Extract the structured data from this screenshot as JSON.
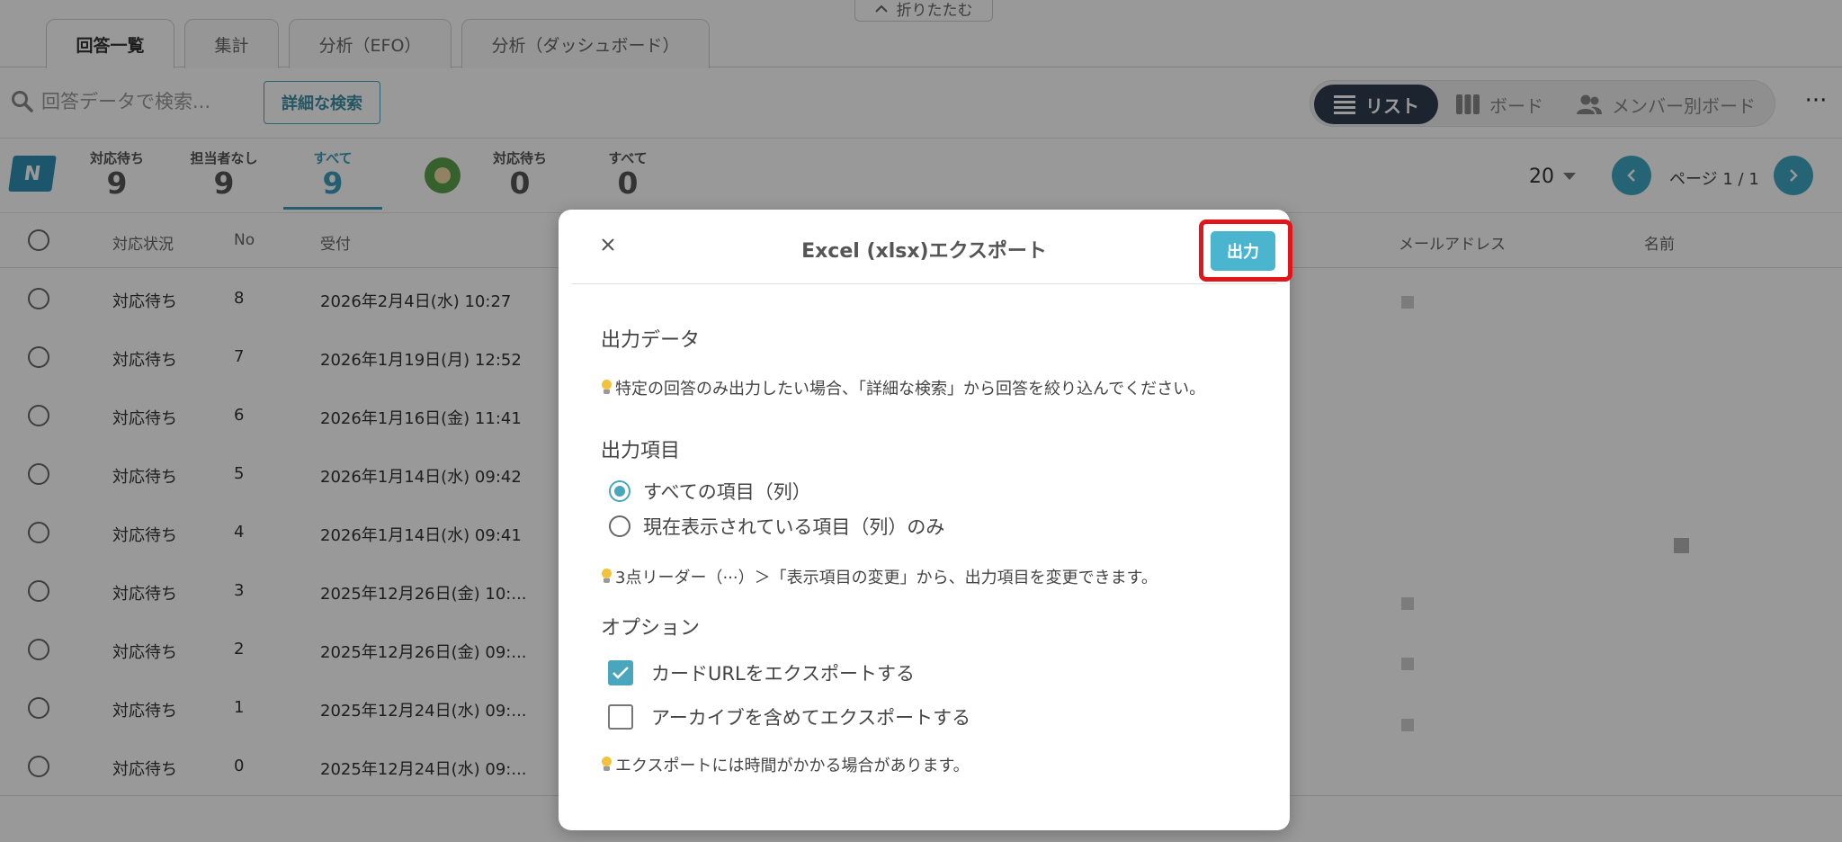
{
  "header": {
    "collapse_label": "折りたたむ",
    "tabs": [
      {
        "label": "回答一覧"
      },
      {
        "label": "集計"
      },
      {
        "label": "分析（EFO）"
      },
      {
        "label": "分析（ダッシュボード）"
      }
    ]
  },
  "toolbar": {
    "search_placeholder": "回答データで検索...",
    "advanced_search_label": "詳細な検索",
    "views": [
      {
        "label": "リスト"
      },
      {
        "label": "ボード"
      },
      {
        "label": "メンバー別ボード"
      }
    ]
  },
  "counters": {
    "logo_letter": "N",
    "team": [
      {
        "label": "対応待ち",
        "value": "9"
      },
      {
        "label": "担当者なし",
        "value": "9"
      },
      {
        "label": "すべて",
        "value": "9"
      }
    ],
    "mine": [
      {
        "label": "対応待ち",
        "value": "0"
      },
      {
        "label": "すべて",
        "value": "0"
      }
    ],
    "per_page": "20",
    "page_label": "ページ 1 / 1"
  },
  "table": {
    "headers": {
      "status": "対応状況",
      "no": "No",
      "received": "受付",
      "email": "メールアドレス",
      "name": "名前"
    },
    "rows": [
      {
        "status": "対応待ち",
        "no": "8",
        "received": "2026年2月4日(水) 10:27"
      },
      {
        "status": "対応待ち",
        "no": "7",
        "received": "2026年1月19日(月) 12:52"
      },
      {
        "status": "対応待ち",
        "no": "6",
        "received": "2026年1月16日(金) 11:41"
      },
      {
        "status": "対応待ち",
        "no": "5",
        "received": "2026年1月14日(水) 09:42"
      },
      {
        "status": "対応待ち",
        "no": "4",
        "received": "2026年1月14日(水) 09:41"
      },
      {
        "status": "対応待ち",
        "no": "3",
        "received": "2025年12月26日(金) 10:..."
      },
      {
        "status": "対応待ち",
        "no": "2",
        "received": "2025年12月26日(金) 09:..."
      },
      {
        "status": "対応待ち",
        "no": "1",
        "received": "2025年12月24日(水) 09:..."
      },
      {
        "status": "対応待ち",
        "no": "0",
        "received": "2025年12月24日(水) 09:..."
      }
    ]
  },
  "modal": {
    "title": "Excel (xlsx)エクスポート",
    "export_label": "出力",
    "output_data_title": "出力データ",
    "output_data_hint": "特定の回答のみ出力したい場合、「詳細な検索」から回答を絞り込んでください。",
    "output_items_title": "出力項目",
    "radio_all": "すべての項目（列）",
    "radio_visible": "現在表示されている項目（列）のみ",
    "items_hint": "3点リーダー（···）＞「表示項目の変更」から、出力項目を変更できます。",
    "options_title": "オプション",
    "option_card_url": "カードURLをエクスポートする",
    "option_archive": "アーカイブを含めてエクスポートする",
    "time_hint": "エクスポートには時間がかかる場合があります。"
  }
}
